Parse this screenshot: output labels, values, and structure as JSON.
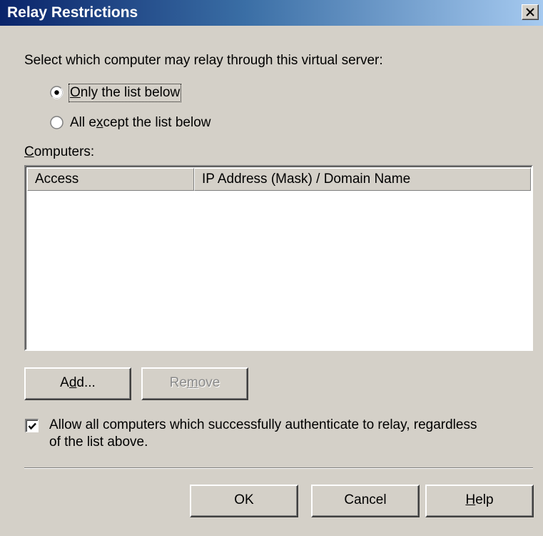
{
  "window": {
    "title": "Relay Restrictions"
  },
  "intro_text": "Select which computer may relay through this virtual server:",
  "radio_options": [
    {
      "pre": "",
      "mnemonic": "O",
      "post": "nly the list below",
      "selected": true
    },
    {
      "pre": "All e",
      "mnemonic": "x",
      "post": "cept the list below",
      "selected": false
    }
  ],
  "computers_label": {
    "mnemonic": "C",
    "post": "omputers:"
  },
  "list": {
    "columns": [
      "Access",
      "IP Address (Mask) / Domain Name"
    ],
    "rows": []
  },
  "buttons": {
    "add": {
      "pre": "A",
      "mnemonic": "d",
      "post": "d..."
    },
    "remove": {
      "pre": "Re",
      "mnemonic": "m",
      "post": "ove",
      "enabled": false
    },
    "ok": "OK",
    "cancel": "Cancel",
    "help": {
      "mnemonic": "H",
      "post": "elp"
    }
  },
  "checkbox": {
    "checked": true,
    "line1": "Allow all computers which successfully authenticate to relay, regardless",
    "line2": "of the list above."
  },
  "colors": {
    "title_bar_start": "#0a246a",
    "title_bar_end": "#a6caf0",
    "dialog_bg": "#d4d0c8"
  }
}
